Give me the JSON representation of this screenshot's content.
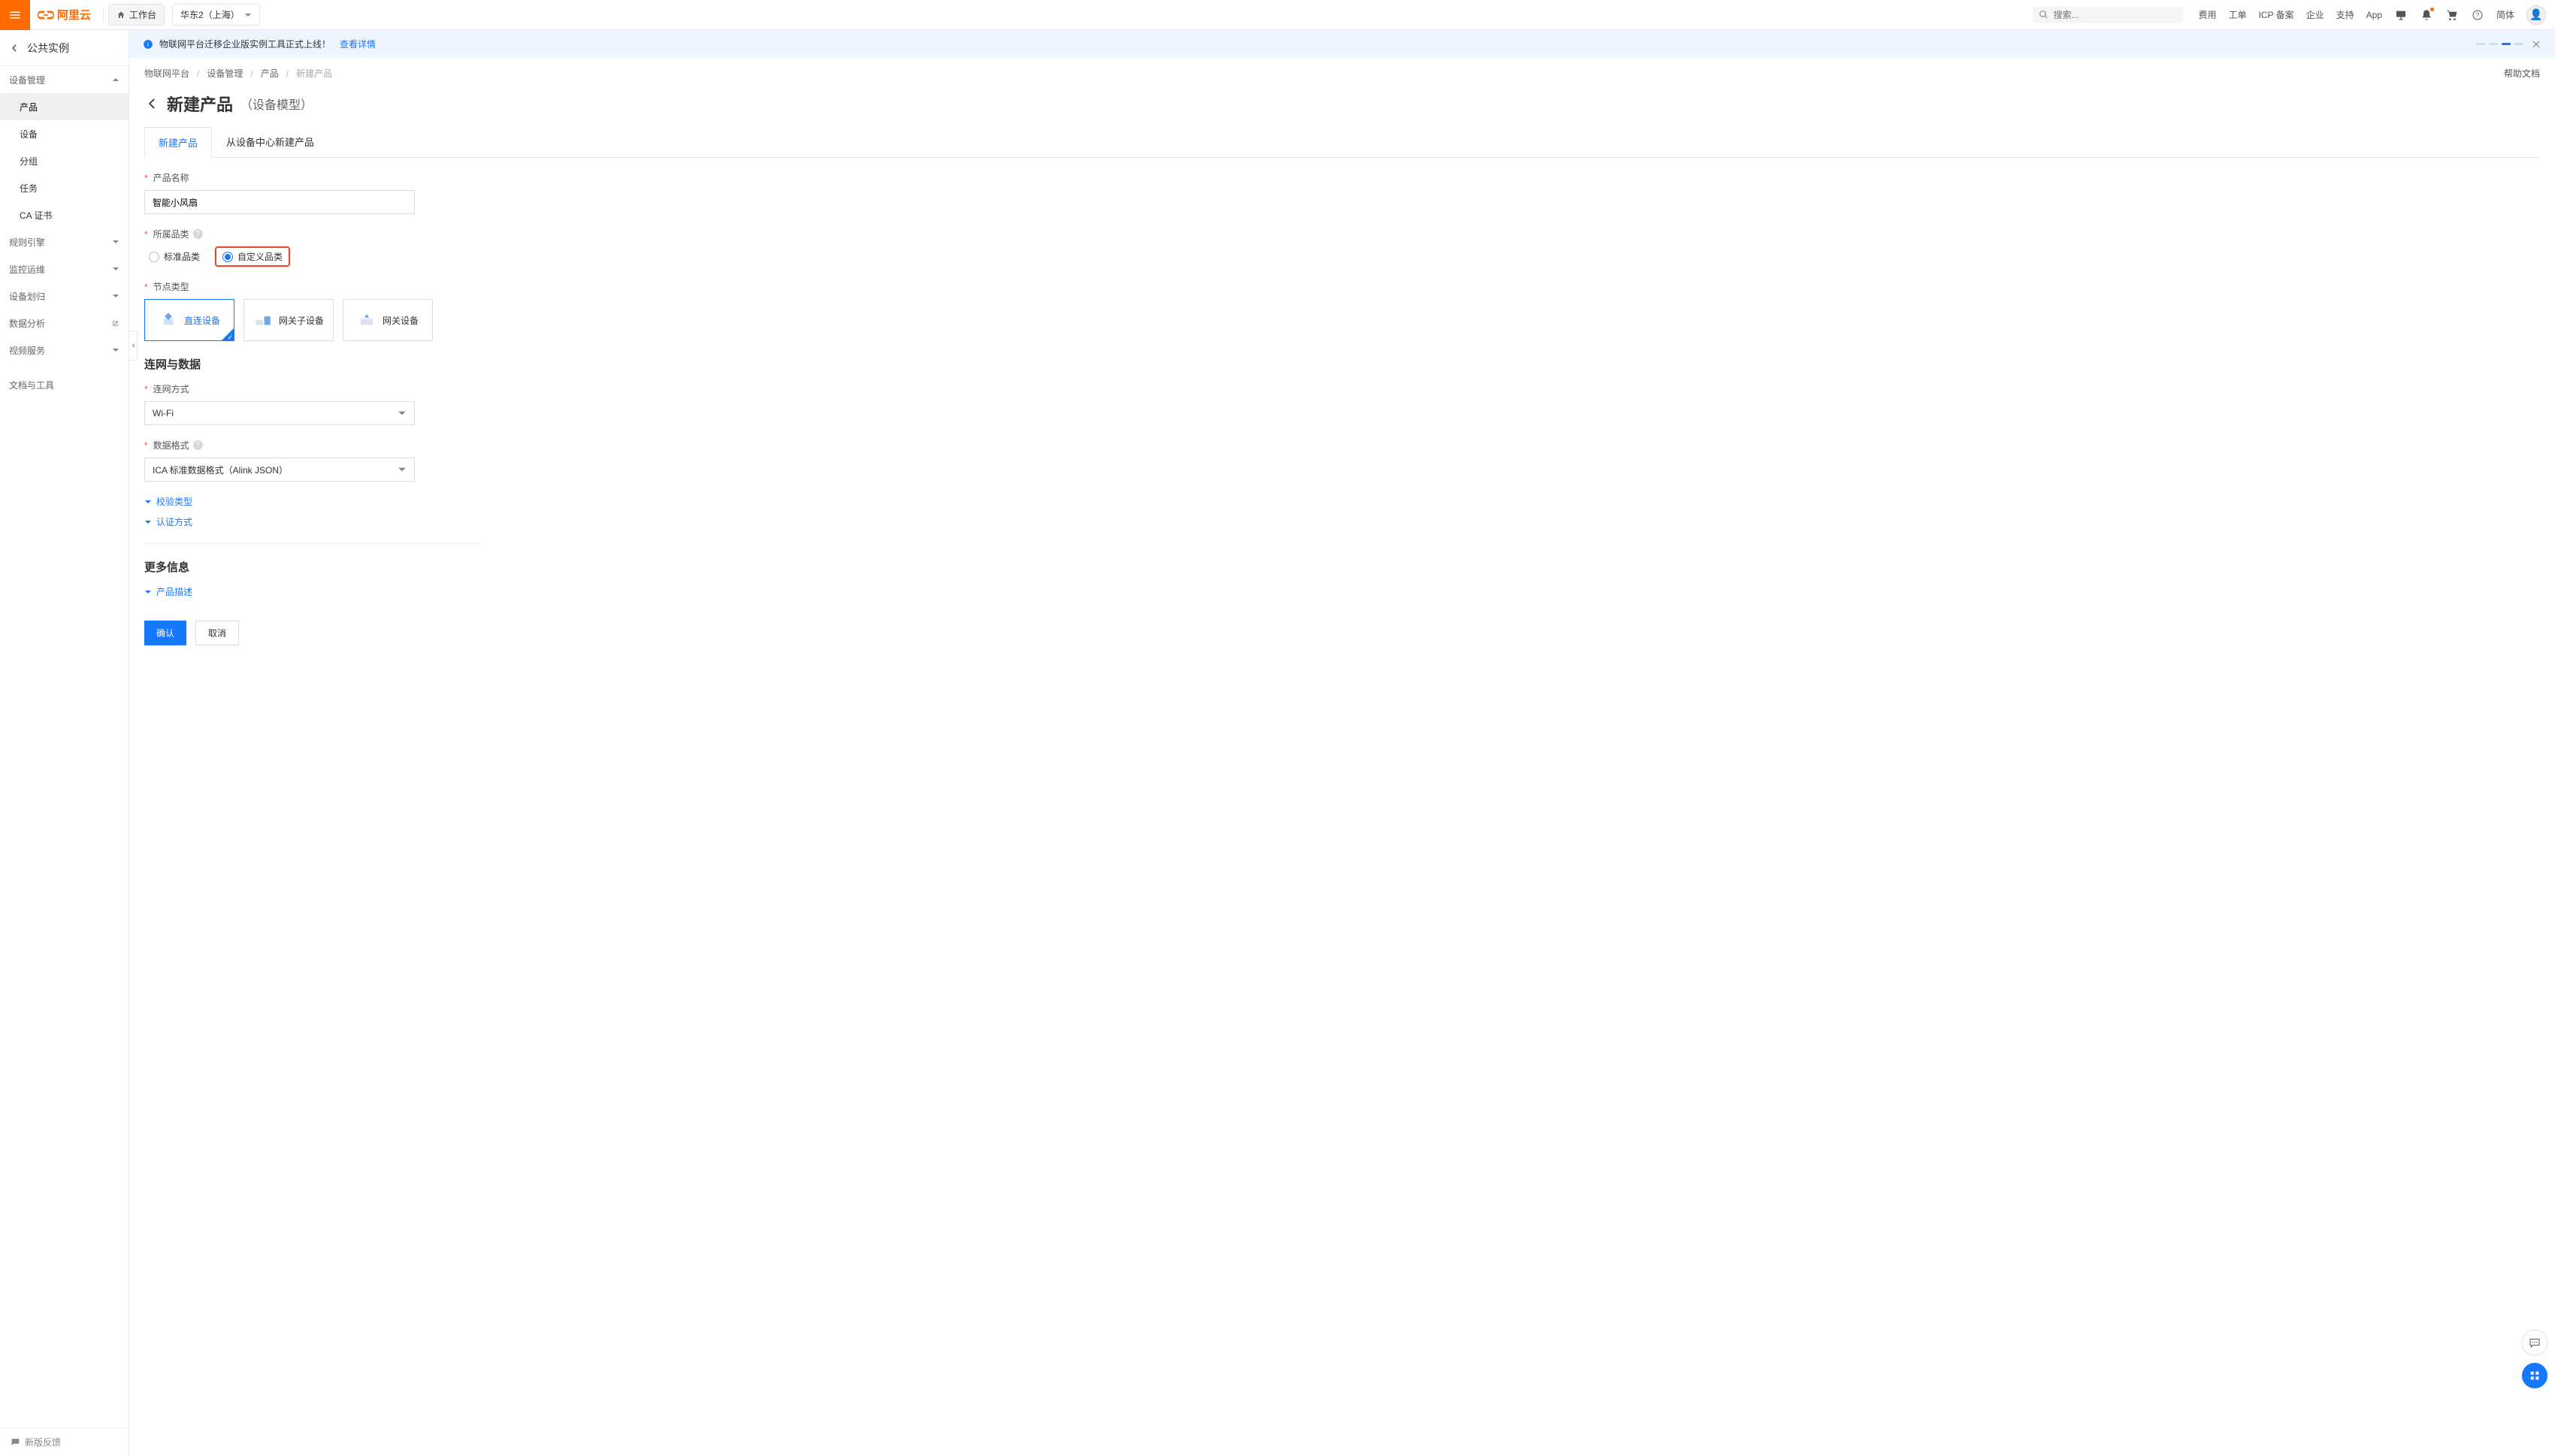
{
  "header": {
    "brand": "阿里云",
    "workbench": "工作台",
    "region": "华东2（上海）",
    "search_placeholder": "搜索...",
    "links": [
      "费用",
      "工单",
      "ICP 备案",
      "企业",
      "支持",
      "App"
    ],
    "lang": "简体"
  },
  "sidebar": {
    "instance": "公共实例",
    "groups": {
      "device_mgmt": {
        "label": "设备管理",
        "items": [
          "产品",
          "设备",
          "分组",
          "任务",
          "CA 证书"
        ],
        "active_index": 0
      },
      "rule_engine": "规则引擎",
      "monitor": "监控运维",
      "partition": "设备划归",
      "data_analysis": "数据分析",
      "video": "视频服务",
      "docs": "文档与工具"
    },
    "footer": "新版反馈"
  },
  "banner": {
    "text": "物联网平台迁移企业版实例工具正式上线！",
    "link": "查看详情"
  },
  "crumbs": {
    "items": [
      "物联网平台",
      "设备管理",
      "产品",
      "新建产品"
    ],
    "help": "帮助文档"
  },
  "page": {
    "title": "新建产品",
    "subtitle": "（设备模型）"
  },
  "tabs": {
    "items": [
      "新建产品",
      "从设备中心新建产品"
    ],
    "active_index": 0
  },
  "form": {
    "product_name_label": "产品名称",
    "product_name_value": "智能小风扇",
    "category_label": "所属品类",
    "category_options": [
      "标准品类",
      "自定义品类"
    ],
    "category_selected_index": 1,
    "node_type_label": "节点类型",
    "node_types": [
      "直连设备",
      "网关子设备",
      "网关设备"
    ],
    "node_type_selected_index": 0,
    "section_network_title": "连网与数据",
    "network_label": "连网方式",
    "network_value": "Wi-Fi",
    "data_format_label": "数据格式",
    "data_format_value": "ICA 标准数据格式（Alink JSON）",
    "verify_type": "校验类型",
    "auth_type": "认证方式",
    "section_more_title": "更多信息",
    "product_desc": "产品描述",
    "confirm": "确认",
    "cancel": "取消"
  }
}
